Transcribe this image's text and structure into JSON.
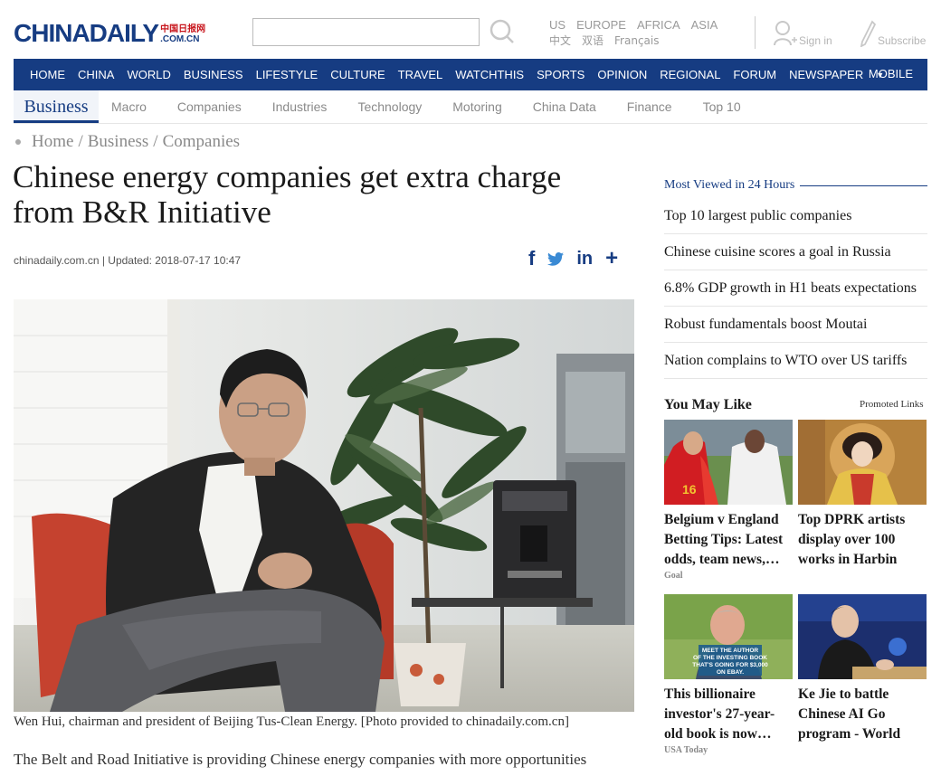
{
  "header": {
    "logo_main_1": "CHINA",
    "logo_main_2": "DAILY",
    "logo_cn": "中国日报网",
    "logo_com": ".COM.CN",
    "search_placeholder": "",
    "editions_row1": [
      "US",
      "EUROPE",
      "AFRICA",
      "ASIA"
    ],
    "editions_row2": [
      "中文",
      "双语",
      "Français"
    ],
    "signin_label": "Sign in",
    "subscribe_label": "Subscribe"
  },
  "nav": {
    "items": [
      "HOME",
      "CHINA",
      "WORLD",
      "BUSINESS",
      "LIFESTYLE",
      "CULTURE",
      "TRAVEL",
      "WATCHTHIS",
      "SPORTS",
      "OPINION",
      "REGIONAL",
      "FORUM",
      "NEWSPAPER"
    ],
    "mobile": "MOBILE",
    "color": "#163c82"
  },
  "subnav": {
    "active": "Business",
    "items": [
      "Macro",
      "Companies",
      "Industries",
      "Technology",
      "Motoring",
      "China Data",
      "Finance",
      "Top 10"
    ]
  },
  "breadcrumb": [
    "Home",
    "Business",
    "Companies"
  ],
  "article": {
    "headline_line1": "Chinese energy companies get extra charge",
    "headline_line2": "from B&R Initiative",
    "meta": "chinadaily.com.cn | Updated: 2018-07-17 10:47",
    "caption": "Wen Hui, chairman and president of Beijing Tus-Clean Energy. [Photo provided to chinadaily.com.cn]",
    "body_first_line": "The Belt and Road Initiative is providing Chinese energy companies with more opportunities"
  },
  "sidebar": {
    "most_viewed_title": "Most Viewed in 24 Hours",
    "most_viewed": [
      "Top 10 largest public companies",
      "Chinese cuisine scores a goal in Russia",
      "6.8% GDP growth in H1 beats expectations",
      "Robust fundamentals boost Moutai",
      "Nation complains to WTO over US tariffs"
    ],
    "you_may_like_title": "You May Like",
    "promoted_label": "Promoted Links",
    "cards": [
      {
        "title": "Belgium v England Betting Tips: Latest odds, team news,…",
        "source": "Goal"
      },
      {
        "title": "Top DPRK artists display over 100 works in Harbin",
        "source": ""
      },
      {
        "title": "This billionaire investor's 27-year-old book is now…",
        "source": "USA Today"
      },
      {
        "title": "Ke Jie to battle Chinese AI Go program - World",
        "source": ""
      }
    ],
    "card3_overlay": [
      "MEET THE AUTHOR",
      "OF THE INVESTING BOOK",
      "THAT'S GOING FOR $3,000",
      "ON EBAY."
    ]
  }
}
